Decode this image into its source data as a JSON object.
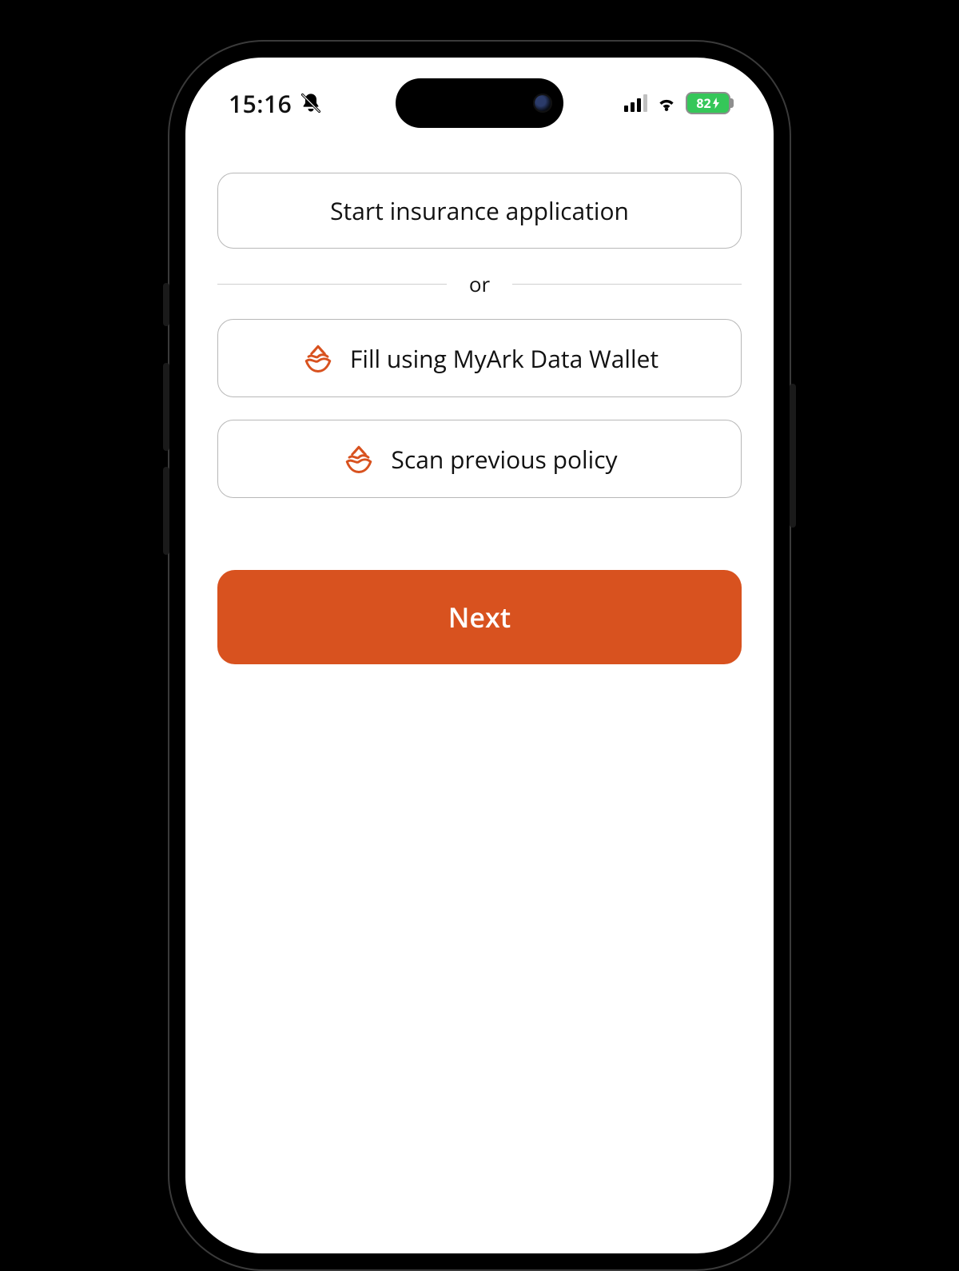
{
  "status": {
    "time": "15:16",
    "silent": true,
    "battery_pct": "82",
    "signal_bars_active": 3,
    "signal_bars_total": 4
  },
  "colors": {
    "accent": "#d8521f",
    "battery": "#35c759"
  },
  "options": {
    "start_label": "Start insurance application",
    "divider_label": "or",
    "wallet_label": "Fill using MyArk Data Wallet",
    "scan_label": "Scan previous policy"
  },
  "next_label": "Next"
}
